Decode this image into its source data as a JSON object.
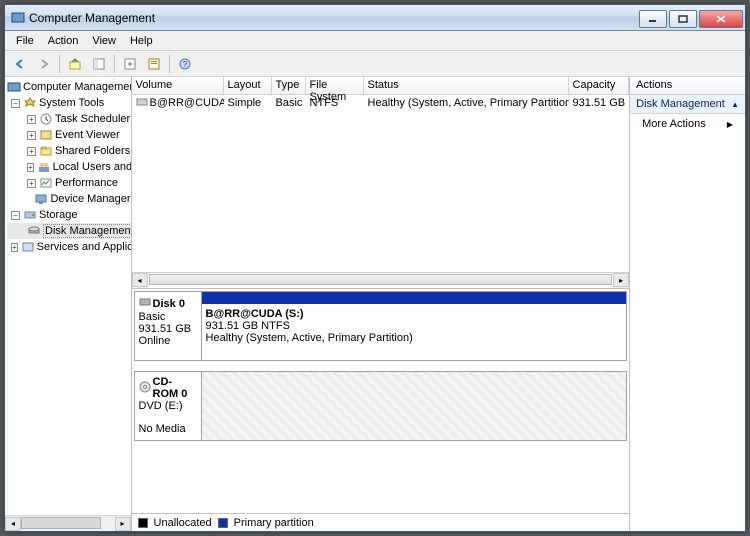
{
  "title": "Computer Management",
  "menu": [
    "File",
    "Action",
    "View",
    "Help"
  ],
  "tree": {
    "root": "Computer Management (Local)",
    "system_tools": "System Tools",
    "task_scheduler": "Task Scheduler",
    "event_viewer": "Event Viewer",
    "shared_folders": "Shared Folders",
    "local_users": "Local Users and Groups",
    "performance": "Performance",
    "device_manager": "Device Manager",
    "storage": "Storage",
    "disk_mgmt": "Disk Management",
    "services": "Services and Applications"
  },
  "volumes": {
    "headers": [
      "Volume",
      "Layout",
      "Type",
      "File System",
      "Status",
      "Capacity"
    ],
    "rows": [
      {
        "name": "B@RR@CUDA  (S:)",
        "layout": "Simple",
        "type": "Basic",
        "fs": "NTFS",
        "status": "Healthy (System, Active, Primary Partition)",
        "cap": "931.51 GB"
      }
    ]
  },
  "disks": [
    {
      "name": "Disk 0",
      "type": "Basic",
      "size": "931.51 GB",
      "state": "Online",
      "part": {
        "name": "B@RR@CUDA   (S:)",
        "detail": "931.51 GB NTFS",
        "status": "Healthy (System, Active, Primary Partition)"
      }
    },
    {
      "name": "CD-ROM 0",
      "type": "DVD (E:)",
      "state": "No Media",
      "empty": true
    }
  ],
  "legend": {
    "unalloc": "Unallocated",
    "primary": "Primary partition"
  },
  "actions": {
    "hdr": "Actions",
    "section": "Disk Management",
    "more": "More Actions"
  }
}
